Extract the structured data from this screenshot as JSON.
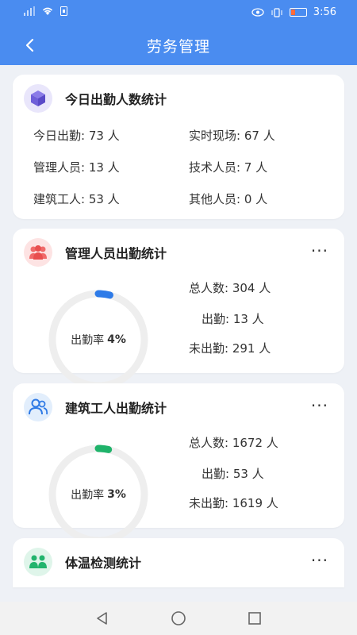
{
  "status_bar": {
    "time": "3:56"
  },
  "app_bar": {
    "title": "劳务管理"
  },
  "today_card": {
    "title": "今日出勤人数统计",
    "rows": [
      {
        "left": "今日出勤:  73 人",
        "right": "实时现场:  67 人"
      },
      {
        "left": "管理人员:  13 人",
        "right": "技术人员:  7 人"
      },
      {
        "left": "建筑工人:  53 人",
        "right": "其他人员:  0 人"
      }
    ]
  },
  "manager_card": {
    "title": "管理人员出勤统计",
    "more": "···",
    "rate_label": "出勤率",
    "rate_value": "4%",
    "rate_fraction": 0.04,
    "accent": "#2e7be8",
    "total": "总人数:  304 人",
    "present": "出勤:  13 人",
    "absent": "未出勤:  291 人"
  },
  "worker_card": {
    "title": "建筑工人出勤统计",
    "more": "···",
    "rate_label": "出勤率",
    "rate_value": "3%",
    "rate_fraction": 0.03,
    "accent": "#1fb36a",
    "total": "总人数:  1672 人",
    "present": "出勤:  53 人",
    "absent": "未出勤:  1619 人"
  },
  "temp_card": {
    "title": "体温检测统计",
    "more": "···"
  },
  "colors": {
    "primary": "#4a8cf0",
    "ring_track": "#eeeeee"
  },
  "icons": {
    "today": "cube-icon",
    "manager": "group-icon",
    "worker": "users-icon",
    "temp": "people-icon"
  }
}
